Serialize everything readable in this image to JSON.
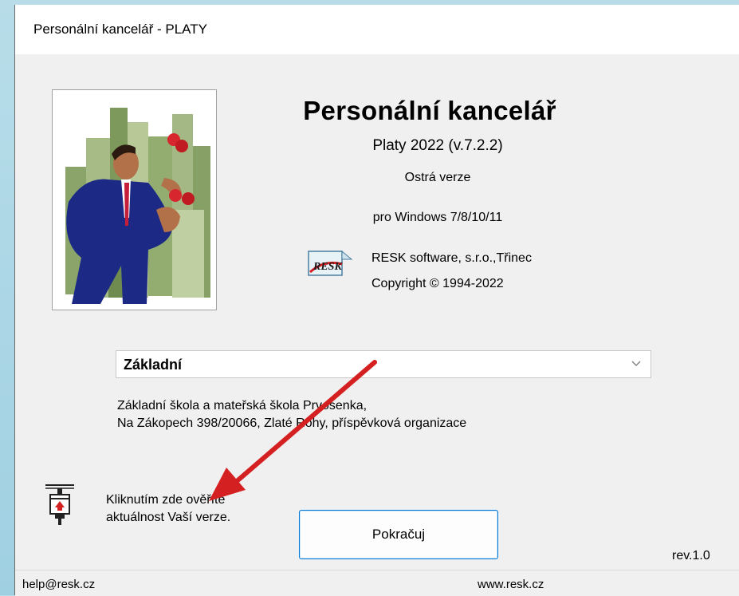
{
  "window": {
    "title": "Personální kancelář - PLATY"
  },
  "about": {
    "app_title": "Personální kancelář",
    "version": "Platy 2022 (v.7.2.2)",
    "edition": "Ostrá verze",
    "platform": "pro Windows 7/8/10/11",
    "company": "RESK software, s.r.o.,Třinec",
    "copyright": "Copyright © 1994-2022",
    "logo_text": "RESK"
  },
  "database_select": {
    "value": "Základní"
  },
  "organization": {
    "line1": "Základní škola a mateřská škola Prvosenka,",
    "line2": "Na Zákopech 398/20066, Zlaté Rohy,  příspěvková organizace"
  },
  "update_check": {
    "line1": "Kliknutím zde ověříte",
    "line2": "aktuálnost Vaší verze."
  },
  "continue_button": {
    "label": "Pokračuj"
  },
  "revision": "rev.1.0",
  "status": {
    "email": "help@resk.cz",
    "website": "www.resk.cz"
  },
  "colors": {
    "accent": "#0078d7",
    "arrow": "#d42020",
    "background": "#f0f0f0"
  }
}
